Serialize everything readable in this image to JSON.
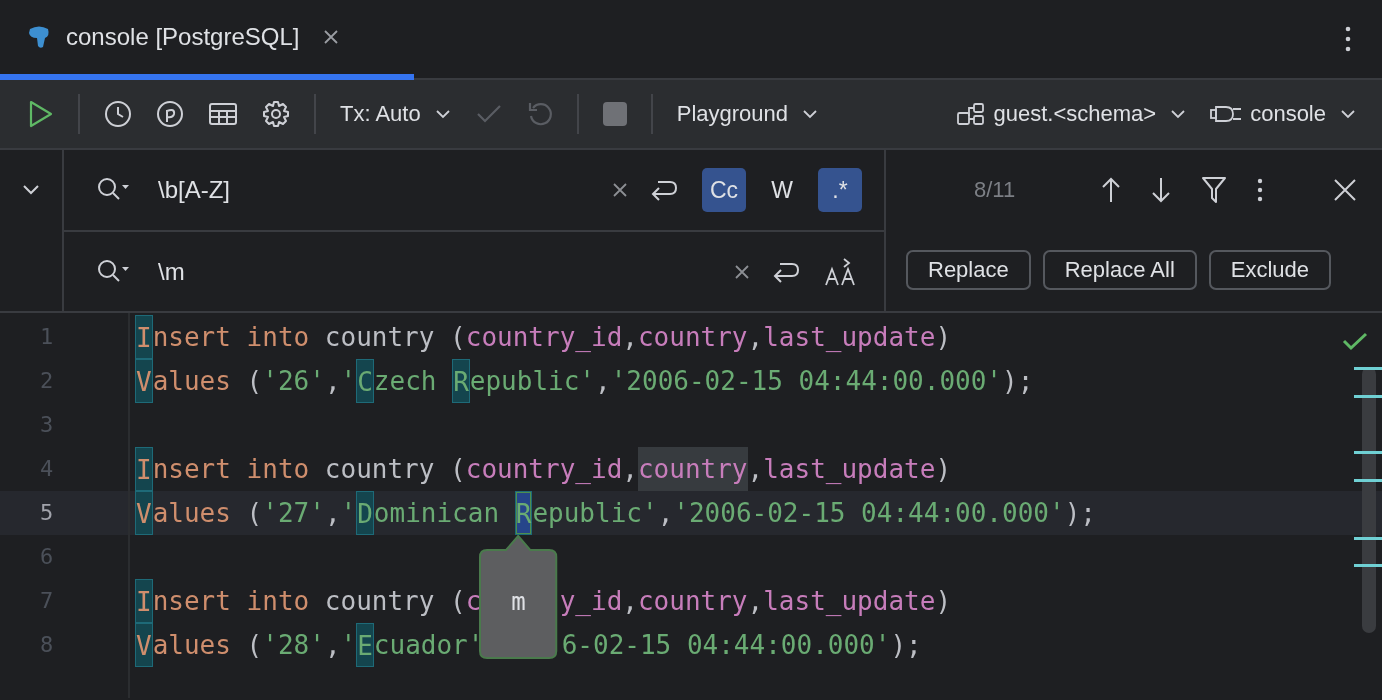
{
  "tab": {
    "title": "console [PostgreSQL]",
    "selected": true
  },
  "toolbar": {
    "tx_mode": "Tx: Auto",
    "playground": "Playground",
    "schema": "guest.<schema>",
    "session": "console"
  },
  "search": {
    "query": "\\b[A-Z]",
    "replace": "\\m",
    "match_count": "8/11",
    "options": [
      {
        "label": "Cc",
        "selected": true
      },
      {
        "label": "W",
        "selected": false
      },
      {
        "label": ".*",
        "selected": true
      }
    ]
  },
  "replace_buttons": [
    "Replace",
    "Replace All",
    "Exclude"
  ],
  "editor": {
    "tooltip": "m",
    "lines": [
      {
        "number": "1",
        "current": false,
        "tokens": [
          {
            "text": "I",
            "kind": "kw",
            "match": true,
            "selected": false,
            "occurrence": false
          },
          {
            "text": "nsert into",
            "kind": "kw",
            "match": false,
            "selected": false,
            "occurrence": false
          },
          {
            "text": " country (",
            "kind": "plain",
            "match": false,
            "selected": false,
            "occurrence": false
          },
          {
            "text": "country_id",
            "kind": "field",
            "match": false,
            "selected": false,
            "occurrence": false
          },
          {
            "text": ",",
            "kind": "plain",
            "match": false,
            "selected": false,
            "occurrence": false
          },
          {
            "text": "country",
            "kind": "field",
            "match": false,
            "selected": false,
            "occurrence": false
          },
          {
            "text": ",",
            "kind": "plain",
            "match": false,
            "selected": false,
            "occurrence": false
          },
          {
            "text": "last_update",
            "kind": "field",
            "match": false,
            "selected": false,
            "occurrence": false
          },
          {
            "text": ")",
            "kind": "plain",
            "match": false,
            "selected": false,
            "occurrence": false
          }
        ]
      },
      {
        "number": "2",
        "current": false,
        "tokens": [
          {
            "text": "V",
            "kind": "kw",
            "match": true,
            "selected": false,
            "occurrence": false
          },
          {
            "text": "alues",
            "kind": "kw",
            "match": false,
            "selected": false,
            "occurrence": false
          },
          {
            "text": " (",
            "kind": "plain",
            "match": false,
            "selected": false,
            "occurrence": false
          },
          {
            "text": "'26'",
            "kind": "str",
            "match": false,
            "selected": false,
            "occurrence": false
          },
          {
            "text": ",",
            "kind": "plain",
            "match": false,
            "selected": false,
            "occurrence": false
          },
          {
            "text": "'",
            "kind": "str",
            "match": false,
            "selected": false,
            "occurrence": false
          },
          {
            "text": "C",
            "kind": "str",
            "match": true,
            "selected": false,
            "occurrence": false
          },
          {
            "text": "zech ",
            "kind": "str",
            "match": false,
            "selected": false,
            "occurrence": false
          },
          {
            "text": "R",
            "kind": "str",
            "match": true,
            "selected": false,
            "occurrence": false
          },
          {
            "text": "epublic'",
            "kind": "str",
            "match": false,
            "selected": false,
            "occurrence": false
          },
          {
            "text": ",",
            "kind": "plain",
            "match": false,
            "selected": false,
            "occurrence": false
          },
          {
            "text": "'2006-02-15 04:44:00.000'",
            "kind": "str",
            "match": false,
            "selected": false,
            "occurrence": false
          },
          {
            "text": ");",
            "kind": "plain",
            "match": false,
            "selected": false,
            "occurrence": false
          }
        ]
      },
      {
        "number": "3",
        "current": false
      },
      {
        "number": "4",
        "current": false,
        "tokens": [
          {
            "text": "I",
            "kind": "kw",
            "match": true,
            "selected": false,
            "occurrence": false
          },
          {
            "text": "nsert into",
            "kind": "kw",
            "match": false,
            "selected": false,
            "occurrence": false
          },
          {
            "text": " country (",
            "kind": "plain",
            "match": false,
            "selected": false,
            "occurrence": false
          },
          {
            "text": "country_id",
            "kind": "field",
            "match": false,
            "selected": false,
            "occurrence": false
          },
          {
            "text": ",",
            "kind": "plain",
            "match": false,
            "selected": false,
            "occurrence": false
          },
          {
            "text": "country",
            "kind": "field",
            "match": false,
            "selected": false,
            "occurrence": true
          },
          {
            "text": ",",
            "kind": "plain",
            "match": false,
            "selected": false,
            "occurrence": false
          },
          {
            "text": "last_update",
            "kind": "field",
            "match": false,
            "selected": false,
            "occurrence": false
          },
          {
            "text": ")",
            "kind": "plain",
            "match": false,
            "selected": false,
            "occurrence": false
          }
        ]
      },
      {
        "number": "5",
        "current": true,
        "tokens": [
          {
            "text": "V",
            "kind": "kw",
            "match": true,
            "selected": false,
            "occurrence": false
          },
          {
            "text": "alues",
            "kind": "kw",
            "match": false,
            "selected": false,
            "occurrence": false
          },
          {
            "text": " (",
            "kind": "plain",
            "match": false,
            "selected": false,
            "occurrence": false
          },
          {
            "text": "'27'",
            "kind": "str",
            "match": false,
            "selected": false,
            "occurrence": false
          },
          {
            "text": ",",
            "kind": "plain",
            "match": false,
            "selected": false,
            "occurrence": false
          },
          {
            "text": "'",
            "kind": "str",
            "match": false,
            "selected": false,
            "occurrence": false
          },
          {
            "text": "D",
            "kind": "str",
            "match": true,
            "selected": false,
            "occurrence": false
          },
          {
            "text": "ominican ",
            "kind": "str",
            "match": false,
            "selected": false,
            "occurrence": false
          },
          {
            "text": "R",
            "kind": "str",
            "match": true,
            "selected": true,
            "occurrence": false
          },
          {
            "text": "epublic'",
            "kind": "str",
            "match": false,
            "selected": false,
            "occurrence": false
          },
          {
            "text": ",",
            "kind": "plain",
            "match": false,
            "selected": false,
            "occurrence": false
          },
          {
            "text": "'2006-02-15 04:44:00.000'",
            "kind": "str",
            "match": false,
            "selected": false,
            "occurrence": false
          },
          {
            "text": ");",
            "kind": "plain",
            "match": false,
            "selected": false,
            "occurrence": false
          }
        ]
      },
      {
        "number": "6",
        "current": false
      },
      {
        "number": "7",
        "current": false,
        "tokens": [
          {
            "text": "I",
            "kind": "kw",
            "match": true,
            "selected": false,
            "occurrence": false
          },
          {
            "text": "nsert into",
            "kind": "kw",
            "match": false,
            "selected": false,
            "occurrence": false
          },
          {
            "text": " country (",
            "kind": "plain",
            "match": false,
            "selected": false,
            "occurrence": false
          },
          {
            "text": "c",
            "kind": "field",
            "match": false,
            "selected": false,
            "occurrence": false
          },
          {
            "kind": "covered",
            "match": false,
            "selected": false,
            "occurrence": false
          },
          {
            "text": "y_id",
            "kind": "field",
            "match": false,
            "selected": false,
            "occurrence": false
          },
          {
            "text": ",",
            "kind": "plain",
            "match": false,
            "selected": false,
            "occurrence": false
          },
          {
            "text": "country",
            "kind": "field",
            "match": false,
            "selected": false,
            "occurrence": false
          },
          {
            "text": ",",
            "kind": "plain",
            "match": false,
            "selected": false,
            "occurrence": false
          },
          {
            "text": "last_update",
            "kind": "field",
            "match": false,
            "selected": false,
            "occurrence": false
          },
          {
            "text": ")",
            "kind": "plain",
            "match": false,
            "selected": false,
            "occurrence": false
          }
        ]
      },
      {
        "number": "8",
        "current": false,
        "tokens": [
          {
            "text": "V",
            "kind": "kw",
            "match": true,
            "selected": false,
            "occurrence": false
          },
          {
            "text": "alues",
            "kind": "kw",
            "match": false,
            "selected": false,
            "occurrence": false
          },
          {
            "text": " (",
            "kind": "plain",
            "match": false,
            "selected": false,
            "occurrence": false
          },
          {
            "text": "'28'",
            "kind": "str",
            "match": false,
            "selected": false,
            "occurrence": false
          },
          {
            "text": ",",
            "kind": "plain",
            "match": false,
            "selected": false,
            "occurrence": false
          },
          {
            "text": "'",
            "kind": "str",
            "match": false,
            "selected": false,
            "occurrence": false
          },
          {
            "text": "E",
            "kind": "str",
            "match": true,
            "selected": false,
            "occurrence": false
          },
          {
            "text": "cuador'",
            "kind": "str",
            "match": false,
            "selected": false,
            "occurrence": false
          },
          {
            "kind": "covered",
            "match": false,
            "selected": false,
            "occurrence": false
          },
          {
            "text": "6-02-15 04:44:00.000'",
            "kind": "str",
            "match": false,
            "selected": false,
            "occurrence": false
          },
          {
            "text": ");",
            "kind": "plain",
            "match": false,
            "selected": false,
            "occurrence": false
          }
        ]
      }
    ]
  }
}
